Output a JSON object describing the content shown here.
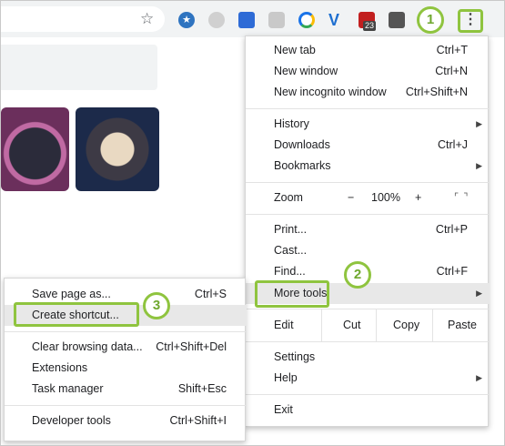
{
  "toolbar": {
    "star_icon": "star-icon",
    "extensions": [
      "extension-icon",
      "extension-icon",
      "translate-icon",
      "skype-icon",
      "chrome-ext-icon",
      "v-icon",
      "badge-ext-icon",
      "film-icon"
    ],
    "badge_count": "23",
    "menu_glyph": "⋮"
  },
  "main_menu": {
    "new_tab": {
      "label": "New tab",
      "shortcut": "Ctrl+T"
    },
    "new_window": {
      "label": "New window",
      "shortcut": "Ctrl+N"
    },
    "new_incognito": {
      "label": "New incognito window",
      "shortcut": "Ctrl+Shift+N"
    },
    "history": {
      "label": "History"
    },
    "downloads": {
      "label": "Downloads",
      "shortcut": "Ctrl+J"
    },
    "bookmarks": {
      "label": "Bookmarks"
    },
    "zoom": {
      "label": "Zoom",
      "minus": "−",
      "value": "100%",
      "plus": "+",
      "fullscreen": "⌜ ⌝"
    },
    "print": {
      "label": "Print...",
      "shortcut": "Ctrl+P"
    },
    "cast": {
      "label": "Cast..."
    },
    "find": {
      "label": "Find...",
      "shortcut": "Ctrl+F"
    },
    "more_tools": {
      "label": "More tools"
    },
    "edit": {
      "label": "Edit",
      "cut": "Cut",
      "copy": "Copy",
      "paste": "Paste"
    },
    "settings": {
      "label": "Settings"
    },
    "help": {
      "label": "Help"
    },
    "exit": {
      "label": "Exit"
    }
  },
  "sub_menu": {
    "save_page": {
      "label": "Save page as...",
      "shortcut": "Ctrl+S"
    },
    "create_shortcut": {
      "label": "Create shortcut..."
    },
    "clear_browsing": {
      "label": "Clear browsing data...",
      "shortcut": "Ctrl+Shift+Del"
    },
    "extensions": {
      "label": "Extensions"
    },
    "task_manager": {
      "label": "Task manager",
      "shortcut": "Shift+Esc"
    },
    "developer_tools": {
      "label": "Developer tools",
      "shortcut": "Ctrl+Shift+I"
    }
  },
  "steps": {
    "one": "1",
    "two": "2",
    "three": "3"
  },
  "colors": {
    "highlight": "#8fc43f",
    "toolbar_bg": "#f1f3f4",
    "hover_bg": "#e8e8e8"
  }
}
